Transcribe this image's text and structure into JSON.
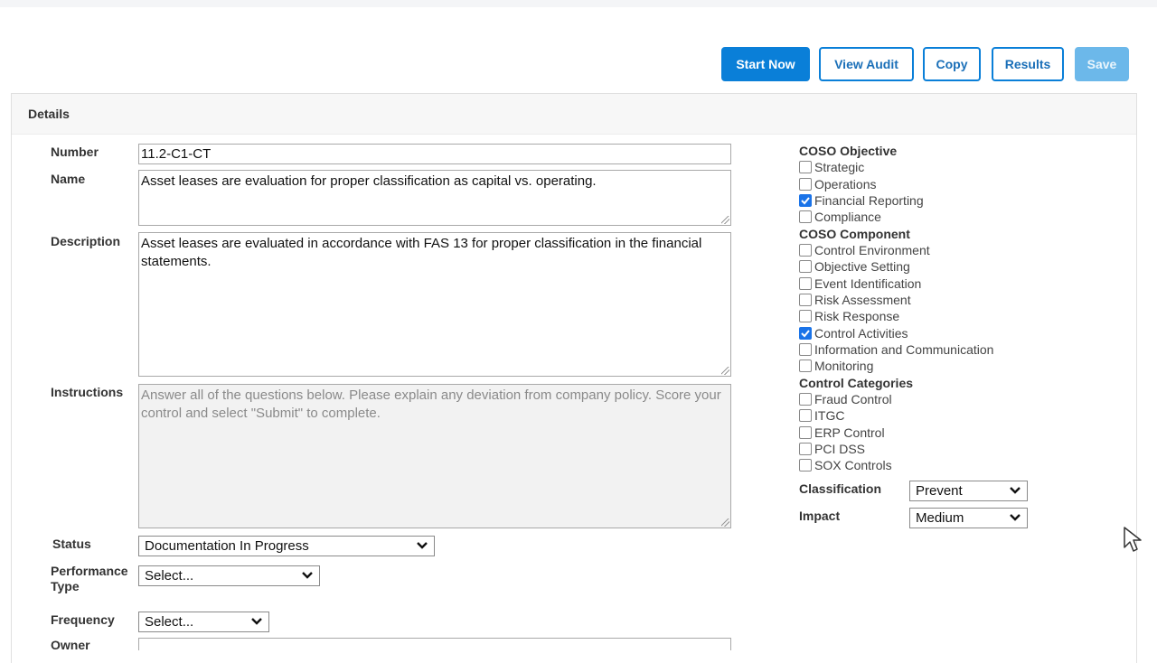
{
  "toolbar": {
    "start_now": "Start Now",
    "view_audit": "View Audit",
    "copy": "Copy",
    "results": "Results",
    "save": "Save"
  },
  "details": {
    "heading": "Details",
    "number": {
      "label": "Number",
      "value": "11.2-C1-CT"
    },
    "name": {
      "label": "Name",
      "value": "Asset leases are evaluation for proper classification as capital vs. operating."
    },
    "description": {
      "label": "Description",
      "value": "Asset leases are evaluated in accordance with FAS 13 for proper classification in the financial statements."
    },
    "instructions": {
      "label": "Instructions",
      "value": "Answer all of the questions below.  Please explain any deviation from company policy.  Score your control and select \"Submit\" to complete."
    },
    "status": {
      "label": "Status",
      "value": "Documentation In Progress"
    },
    "performance_type": {
      "label_line1": "Performance",
      "label_line2": "Type",
      "value": "Select..."
    },
    "frequency": {
      "label": "Frequency",
      "value": "Select..."
    },
    "owner": {
      "label": "Owner",
      "value": ""
    }
  },
  "coso_objective": {
    "title": "COSO Objective",
    "items": [
      {
        "label": "Strategic",
        "checked": false
      },
      {
        "label": "Operations",
        "checked": false
      },
      {
        "label": "Financial Reporting",
        "checked": true
      },
      {
        "label": "Compliance",
        "checked": false
      }
    ]
  },
  "coso_component": {
    "title": "COSO Component",
    "items": [
      {
        "label": "Control Environment",
        "checked": false
      },
      {
        "label": "Objective Setting",
        "checked": false
      },
      {
        "label": "Event Identification",
        "checked": false
      },
      {
        "label": "Risk Assessment",
        "checked": false
      },
      {
        "label": "Risk Response",
        "checked": false
      },
      {
        "label": "Control Activities",
        "checked": true
      },
      {
        "label": "Information and Communication",
        "checked": false
      },
      {
        "label": "Monitoring",
        "checked": false
      }
    ]
  },
  "control_categories": {
    "title": "Control Categories",
    "items": [
      {
        "label": "Fraud Control",
        "checked": false
      },
      {
        "label": "ITGC",
        "checked": false
      },
      {
        "label": "ERP Control",
        "checked": false
      },
      {
        "label": "PCI DSS",
        "checked": false
      },
      {
        "label": "SOX Controls",
        "checked": false
      }
    ]
  },
  "classification": {
    "label": "Classification",
    "value": "Prevent"
  },
  "impact": {
    "label": "Impact",
    "value": "Medium"
  },
  "colors": {
    "primary": "#0a7fd8",
    "disabled": "#6cb8ea",
    "checked": "#1a73e8"
  }
}
